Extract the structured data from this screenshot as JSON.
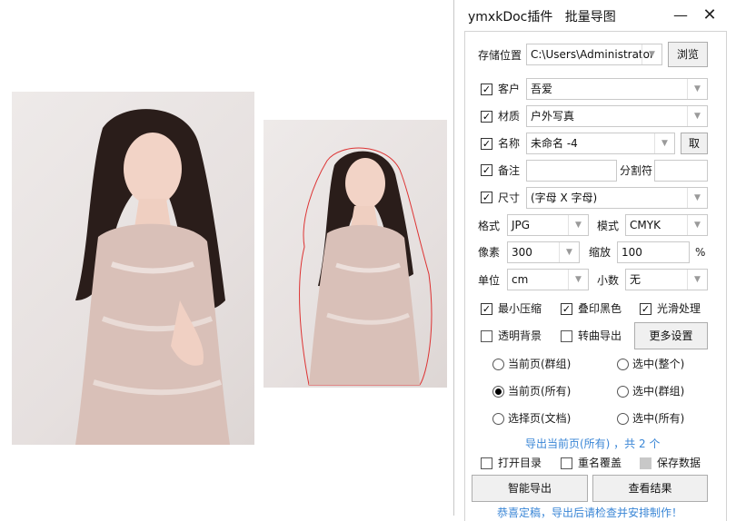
{
  "window": {
    "title": "ymxkDoc插件   批量导图",
    "minimize": "—",
    "close": "✕"
  },
  "form": {
    "storage_label": "存储位置",
    "storage_value": "C:\\Users\\Administrator",
    "browse_button": "浏览",
    "customer_label": "客户",
    "customer_value": "吾爱",
    "material_label": "材质",
    "material_value": "户外写真",
    "name_label": "名称",
    "name_value": "未命名 -4",
    "name_pick_button": "取",
    "remark_label": "备注",
    "separator_label": "分割符",
    "size_label": "尺寸",
    "size_value": "(字母 X 字母)",
    "format_label": "格式",
    "format_value": "JPG",
    "mode_label": "模式",
    "mode_value": "CMYK",
    "pixel_label": "像素",
    "pixel_value": "300",
    "scale_label": "缩放",
    "scale_value": "100",
    "scale_unit": "%",
    "unit_label": "单位",
    "unit_value": "cm",
    "decimal_label": "小数",
    "decimal_value": "无"
  },
  "options": {
    "min_compress": "最小压缩",
    "overprint_black": "叠印黑色",
    "smooth": "光滑处理",
    "transparent_bg": "透明背景",
    "curve_export": "转曲导出",
    "more_settings_button": "更多设置"
  },
  "radios": {
    "current_page_group": "当前页(群组)",
    "selected_whole": "选中(整个)",
    "current_page_all": "当前页(所有)",
    "selected_group": "选中(群组)",
    "select_page_doc": "选择页(文档)",
    "selected_all": "选中(所有)"
  },
  "status": {
    "export_info": "导出当前页(所有) ，共 2 个",
    "bottom_msg": "恭喜定稿，导出后请检查并安排制作！"
  },
  "extras": {
    "open_dir": "打开目录",
    "rename_cover": "重名覆盖",
    "save_data": "保存数据"
  },
  "actions": {
    "smart_export_button": "智能导出",
    "view_result_button": "查看结果"
  },
  "marks": {
    "check": "✓",
    "arrow": "▼"
  }
}
